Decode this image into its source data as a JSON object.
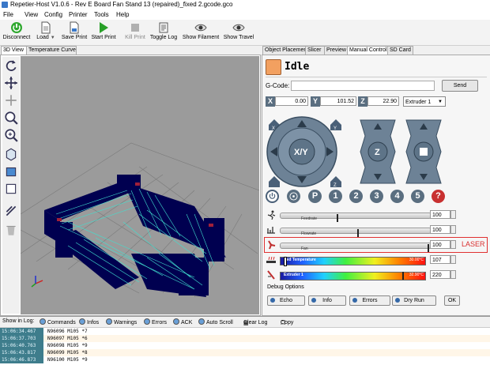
{
  "window": {
    "title": "Repetier-Host V1.0.6 - Rev E Board Fan Stand 13 (repaired)_fixed 2.gcode.gco"
  },
  "menu": [
    "File",
    "View",
    "Config",
    "Printer",
    "Tools",
    "Help"
  ],
  "toolbar": {
    "connect": "Disconnect",
    "load": "Load",
    "save_print": "Save Print",
    "start_print": "Start Print",
    "kill_print": "Kill Print",
    "toggle_log": "Toggle Log",
    "show_filament": "Show Filament",
    "show_travel": "Show Travel"
  },
  "left_tabs": [
    "3D View",
    "Temperature Curve"
  ],
  "right_tabs": [
    "Object Placement",
    "Slicer",
    "Preview",
    "Manual Control",
    "SD Card"
  ],
  "manual": {
    "status": "Idle",
    "gcode_label": "G-Code:",
    "gcode_value": "",
    "send": "Send",
    "x_label": "X",
    "x_value": "0.00",
    "y_label": "Y",
    "y_value": "101.52",
    "z_label": "Z",
    "z_value": "22.90",
    "extruder": "Extruder 1",
    "xy_label": "X/Y",
    "z_button": "Z",
    "home_x": "X",
    "home_y": "Y",
    "home_z": "Z",
    "keys": [
      "P",
      "1",
      "2",
      "3",
      "4",
      "5",
      "?"
    ],
    "feedrate_label": "Feedrate",
    "feedrate_value": "100",
    "feedrate_level": 0.38,
    "flowrate_label": "Flowrate",
    "flowrate_value": "100",
    "flowrate_level": 0.52,
    "fan_label": "Fan",
    "fan_value": "100",
    "fan_level": 1.0,
    "fan_annotation": "LASER",
    "bed_label": "Bed Temperature",
    "bed_temp": "30.00°C",
    "bed_target": "107",
    "bed_level": 0.02,
    "ext_label": "Extruder 1",
    "ext_temp": "32.90°C",
    "ext_target": "220",
    "ext_level": 0.86,
    "debug_title": "Debug Options",
    "debug_buttons": [
      "Echo",
      "Info",
      "Errors",
      "Dry Run"
    ],
    "ok": "OK"
  },
  "log": {
    "label": "Show in Log:",
    "filters": [
      "Commands",
      "Infos",
      "Warnings",
      "Errors",
      "ACK",
      "Auto Scroll",
      "Clear Log",
      "Copy"
    ],
    "rows": [
      {
        "ts": "15:06:34.467",
        "msg": "N96096 M105 *7"
      },
      {
        "ts": "15:06:37.703",
        "msg": "N96097 M105 *6"
      },
      {
        "ts": "15:06:40.763",
        "msg": "N96098 M105 *9"
      },
      {
        "ts": "15:06:43.817",
        "msg": "N96099 M105 *8"
      },
      {
        "ts": "15:06:46.873",
        "msg": "N96100 M105 *9"
      }
    ]
  },
  "colors": {
    "accent": "#5a6e80",
    "annotation": "#d93030"
  }
}
